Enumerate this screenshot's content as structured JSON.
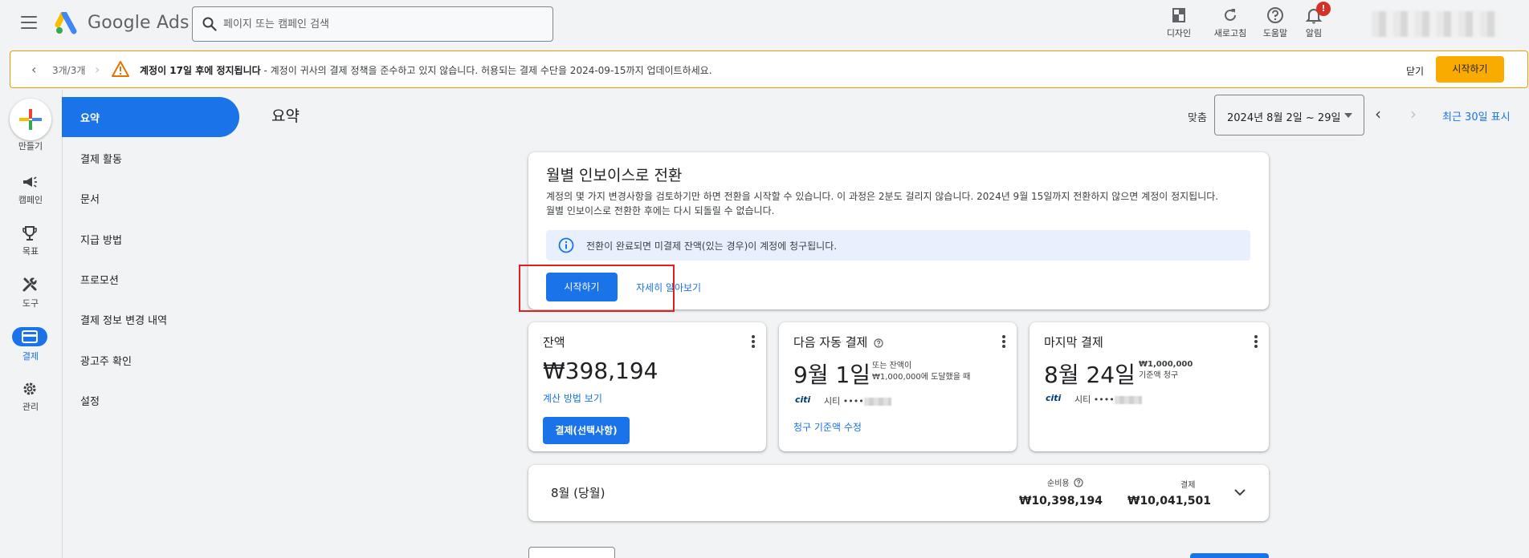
{
  "app": {
    "brand": "Google Ads"
  },
  "search": {
    "placeholder": "페이지 또는 캠페인 검색"
  },
  "top_actions": [
    {
      "label": "디자인",
      "icon": "design-icon"
    },
    {
      "label": "새로고침",
      "icon": "refresh-icon"
    },
    {
      "label": "도움말",
      "icon": "help-icon"
    },
    {
      "label": "알림",
      "icon": "bell-icon",
      "badge": "!"
    }
  ],
  "banner": {
    "pager": "3개/3개",
    "bold_text": "계정이 17일 후에 정지됩니다",
    "text": " - 계정이 귀사의 결제 정책을 준수하고 있지 않습니다. 허용되는 결제 수단을 2024-09-15까지 업데이트하세요.",
    "dismiss": "닫기",
    "start": "시작하기"
  },
  "rail": [
    {
      "label": "만들기",
      "icon": "plus-icon"
    },
    {
      "label": "캠페인",
      "icon": "megaphone-icon"
    },
    {
      "label": "목표",
      "icon": "trophy-icon"
    },
    {
      "label": "도구",
      "icon": "tools-icon"
    },
    {
      "label": "결제",
      "icon": "credit-card-icon",
      "active": true
    },
    {
      "label": "관리",
      "icon": "gear-icon"
    }
  ],
  "subnav": [
    {
      "label": "요약",
      "active": true
    },
    {
      "label": "결제 활동"
    },
    {
      "label": "문서"
    },
    {
      "label": "지급 방법"
    },
    {
      "label": "프로모션"
    },
    {
      "label": "결제 정보 변경 내역"
    },
    {
      "label": "광고주 확인"
    },
    {
      "label": "설정"
    }
  ],
  "header": {
    "title": "요약",
    "range_label": "맞춤",
    "date_range": "2024년 8월 2일 ~ 29일",
    "recent": "최근 30일 표시"
  },
  "invoice": {
    "title": "월별 인보이스로 전환",
    "desc1": "계정의 몇 가지 변경사항을 검토하기만 하면 전환을 시작할 수 있습니다. 이 과정은 2분도 걸리지 않습니다. 2024년 9월 15일까지 전환하지 않으면 계정이 정지됩니다.",
    "desc2": "월별 인보이스로 전환한 후에는 다시 되돌릴 수 없습니다.",
    "info": "전환이 완료되면 미결제 잔액(있는 경우)이 계정에 청구됩니다.",
    "start": "시작하기",
    "learn": "자세히 알아보기"
  },
  "balance": {
    "title": "잔액",
    "value": "₩398,194",
    "link": "계산 방법 보기",
    "button": "결제(선택사항)"
  },
  "next_payment": {
    "title": "다음 자동 결제",
    "date": "9월 1일",
    "note1": "또는 잔액이",
    "note2": "₩1,000,000에 도달했을 때",
    "bank": "citi",
    "card": "시티 ••••",
    "link": "청구 기준액 수정"
  },
  "last_payment": {
    "title": "마지막 결제",
    "date": "8월 24일",
    "amount": "₩1,000,000",
    "note": "기준액 청구",
    "bank": "citi",
    "card": "시티 ••••"
  },
  "month": {
    "title": "8월 (당월)",
    "cost_label": "순비용",
    "cost_value": "₩10,398,194",
    "paid_label": "결제",
    "paid_value": "₩10,041,501"
  }
}
